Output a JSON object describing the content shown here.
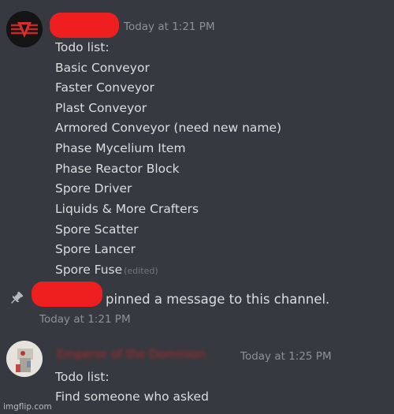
{
  "message1": {
    "timestamp": "Today at 1:21 PM",
    "lines": [
      "Todo list:",
      "Basic Conveyor",
      "Faster Conveyor",
      "Plast Conveyor",
      "Armored Conveyor (need new name)",
      "Phase Mycelium Item",
      "Phase Reactor Block",
      "Spore Driver",
      "Liquids & More Crafters",
      "Spore Scatter",
      "Spore Lancer"
    ],
    "last_line": "Spore Fuse",
    "edited_label": "(edited)"
  },
  "system_message": {
    "text": "pinned a message to this channel.",
    "timestamp": "Today at 1:21 PM"
  },
  "message2": {
    "username": "Emperor of the Dominion",
    "timestamp": "Today at 1:25 PM",
    "lines": [
      "Todo list:",
      "Find someone who asked"
    ]
  },
  "watermark": "imgflip.com",
  "colors": {
    "background": "#36393f",
    "text": "#dcddde",
    "timestamp": "#8e9297",
    "redaction": "#f01f1f",
    "username_red": "#e02424"
  },
  "icons": {
    "avatar1": "red-emblem-avatar",
    "pin": "pin-icon",
    "avatar2": "photo-avatar"
  }
}
